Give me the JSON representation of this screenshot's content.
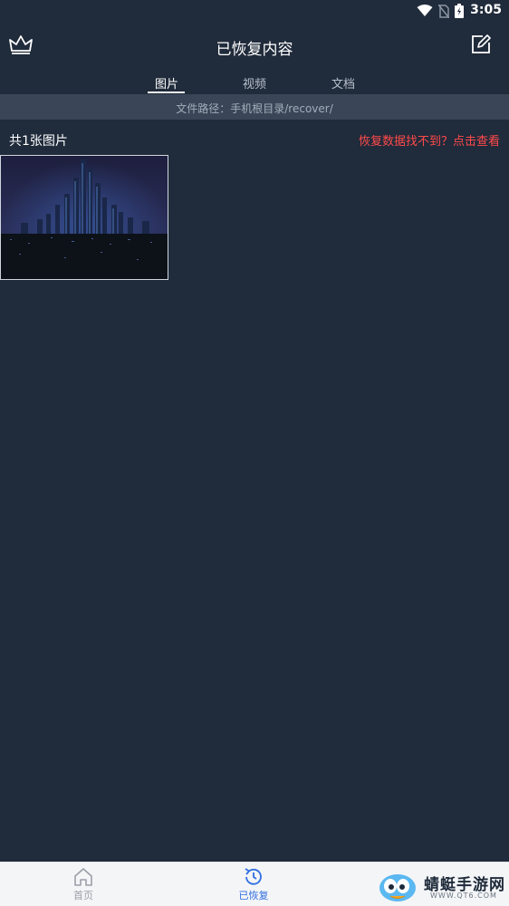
{
  "status": {
    "time": "3:05"
  },
  "header": {
    "title": "已恢复内容",
    "crown_icon": "crown-icon",
    "edit_icon": "edit-icon"
  },
  "tabs": [
    {
      "label": "图片",
      "active": true
    },
    {
      "label": "视频",
      "active": false
    },
    {
      "label": "文档",
      "active": false
    }
  ],
  "path": {
    "text": "文件路径：手机根目录/recover/"
  },
  "summary": {
    "count_label": "共1张图片",
    "help_link": "恢复数据找不到？点击查看"
  },
  "thumbnails": [
    {
      "icon": "city-night-image"
    }
  ],
  "bottom_nav": [
    {
      "label": "首页",
      "icon": "home-icon",
      "color": "#9aa0a8"
    },
    {
      "label": "已恢复",
      "icon": "history-icon",
      "color": "#2f6fe0"
    }
  ],
  "watermark": {
    "text": "蜻蜓手游网",
    "sub": "WWW.QT6.COM"
  },
  "colors": {
    "background": "#202b3b",
    "path_bar": "#3a4658",
    "accent_red": "#ff4a4a",
    "nav_active": "#2f6fe0"
  }
}
